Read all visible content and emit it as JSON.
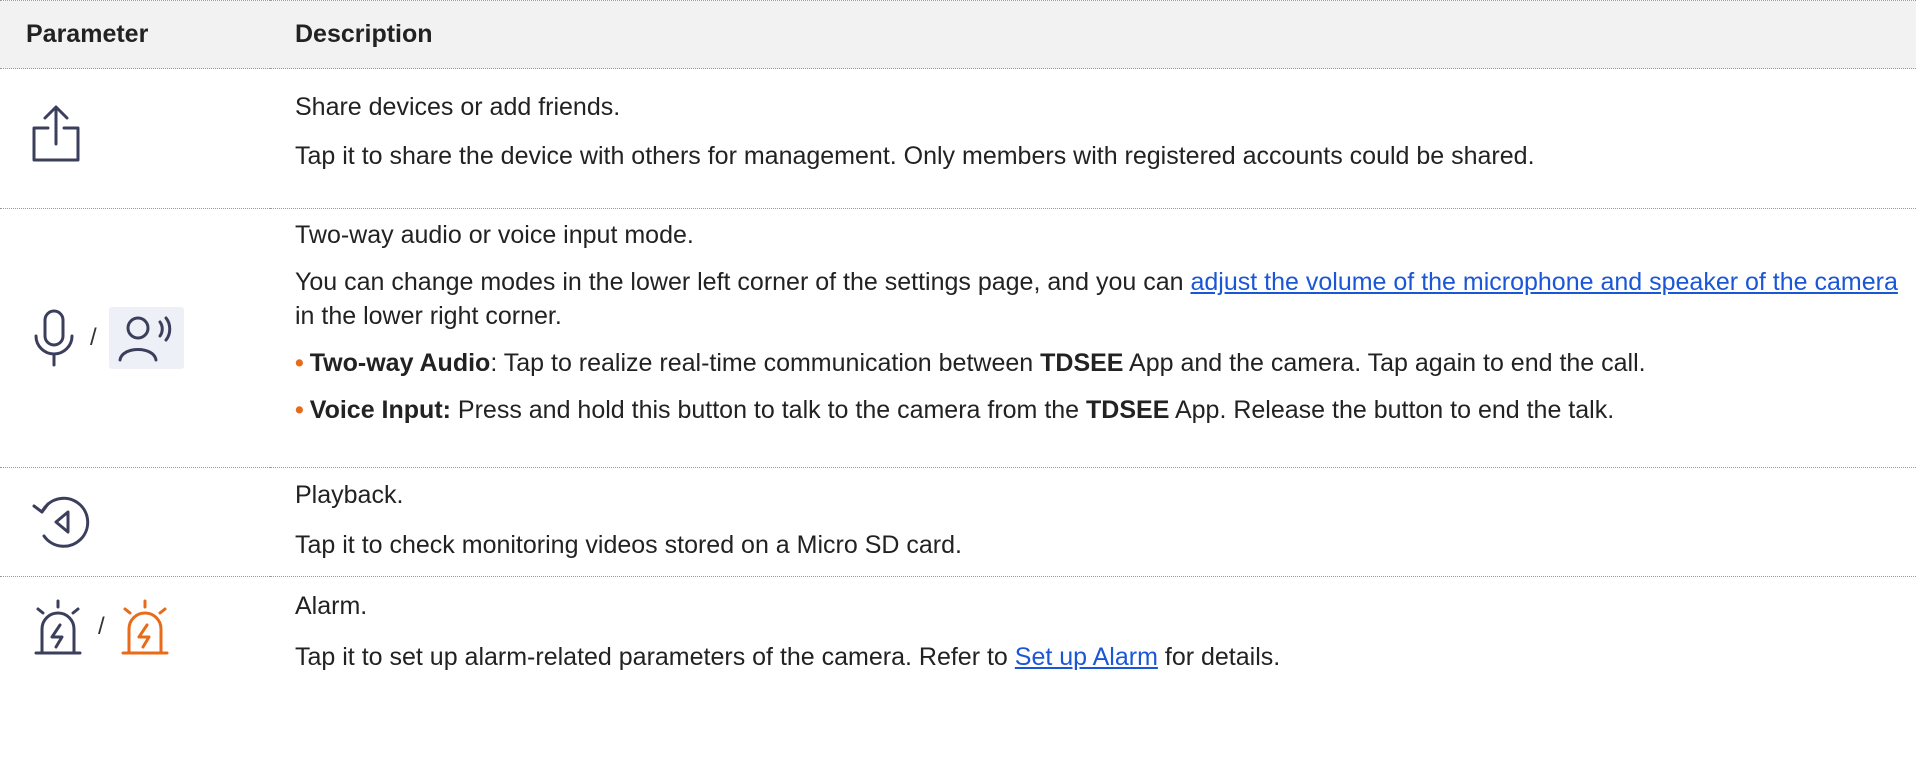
{
  "header": {
    "param": "Parameter",
    "desc": "Description"
  },
  "rows": [
    {
      "icon_names": [
        "share-icon"
      ],
      "title": "Share devices or add friends.",
      "body": "Tap it to share the device with others for management. Only members with registered accounts could be shared."
    },
    {
      "icon_names": [
        "microphone-icon",
        "voice-speaking-icon"
      ],
      "separator": "/",
      "title": "Two-way audio or voice input mode.",
      "body_pre": "You can change modes in the lower left corner of the settings page, and you can ",
      "link": "adjust the volume of the microphone and speaker of the camera",
      "body_post": " in the lower right corner.",
      "bullets": [
        {
          "bullet": "•",
          "label": "Two-way Audio",
          "after_label": ": Tap to realize real-time communication between ",
          "app": "TDSEE",
          "tail": " App and the camera. Tap again to end the call."
        },
        {
          "bullet": "•",
          "label": "Voice Input:",
          "after_label": " Press and hold this button to talk to the camera from the ",
          "app": "TDSEE",
          "tail": " App. Release the button to end the talk."
        }
      ]
    },
    {
      "icon_names": [
        "playback-icon"
      ],
      "title": "Playback.",
      "body": "Tap it to check monitoring videos stored on a Micro SD card."
    },
    {
      "icon_names": [
        "alarm-off-icon",
        "alarm-on-icon"
      ],
      "separator": "/",
      "title": "Alarm.",
      "body_pre": "Tap it to set up alarm-related parameters of the camera. Refer to ",
      "link": "Set up Alarm",
      "body_post": " for details."
    }
  ],
  "colors": {
    "icon": "#3b3f5c",
    "accent": "#e86b1a",
    "link": "#1a56d6",
    "header_bg": "#f2f2f2"
  }
}
